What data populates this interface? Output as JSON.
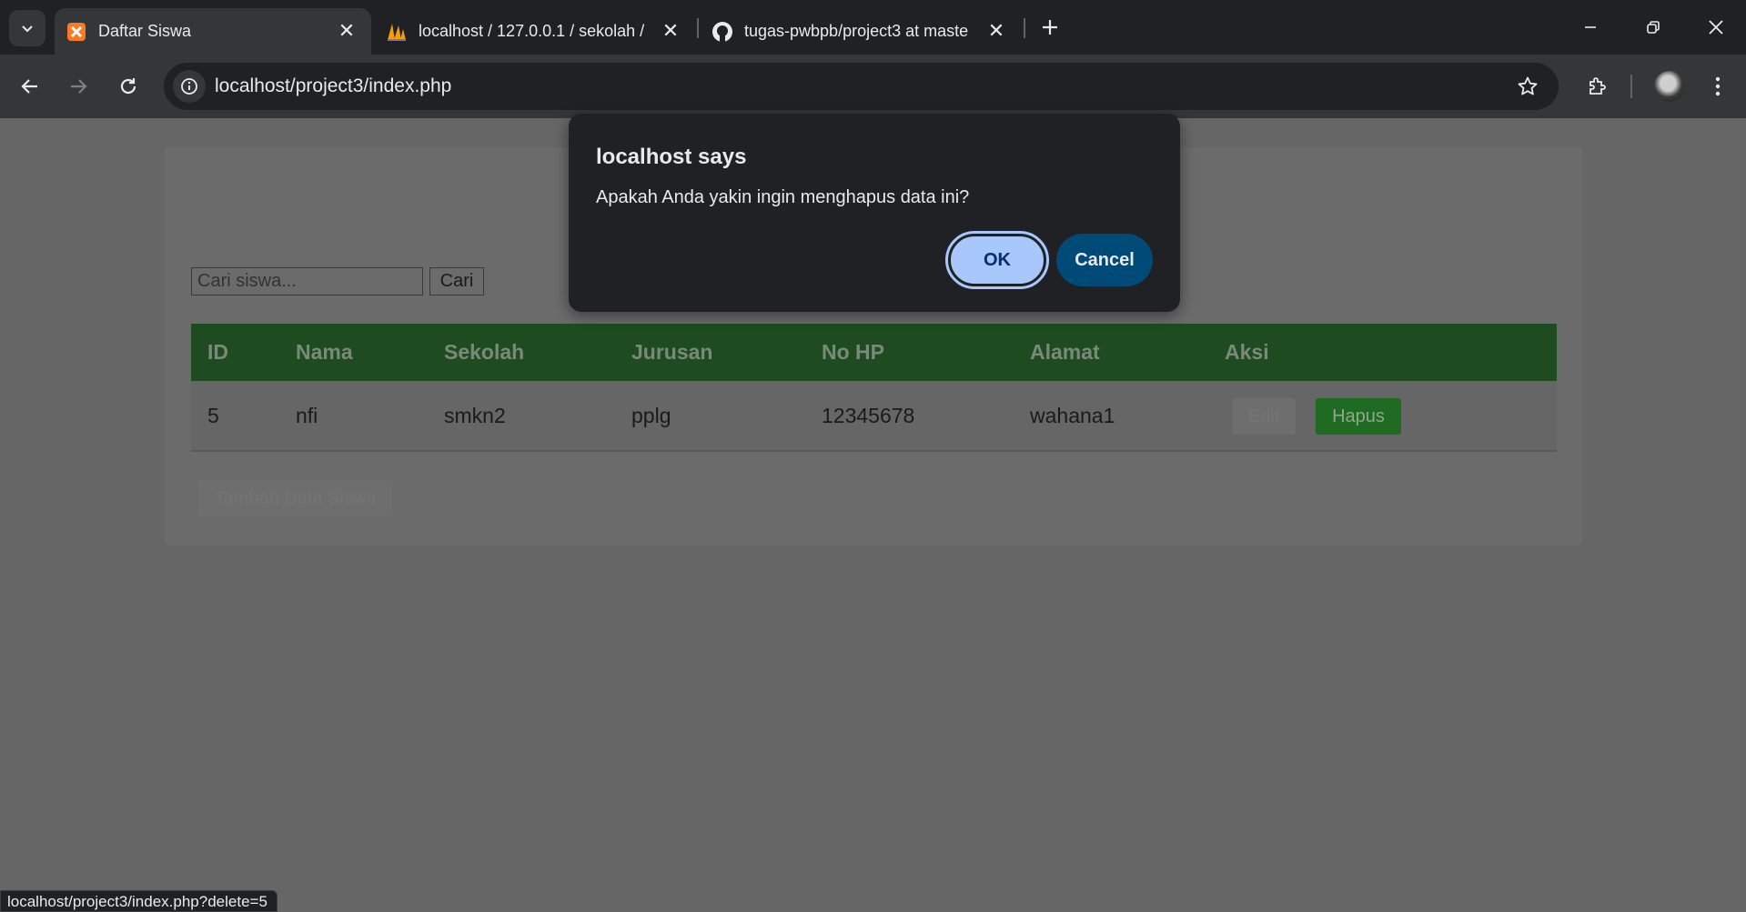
{
  "tabs": [
    {
      "title": "Daftar Siswa",
      "active": true,
      "favicon": "xampp-icon"
    },
    {
      "title": "localhost / 127.0.0.1 / sekolah / ",
      "active": false,
      "favicon": "phpmyadmin-icon"
    },
    {
      "title": "tugas-pwbpb/project3 at maste",
      "active": false,
      "favicon": "github-icon"
    }
  ],
  "toolbar": {
    "url": "localhost/project3/index.php"
  },
  "page": {
    "search_placeholder": "Cari siswa...",
    "search_button": "Cari",
    "table": {
      "headers": [
        "ID",
        "Nama",
        "Sekolah",
        "Jurusan",
        "No HP",
        "Alamat",
        "Aksi"
      ],
      "rows": [
        {
          "id": "5",
          "nama": "nfi",
          "sekolah": "smkn2",
          "jurusan": "pplg",
          "no_hp": "12345678",
          "alamat": "wahana1"
        }
      ],
      "edit_label": "Edit",
      "delete_label": "Hapus"
    },
    "add_button": "Tambah Data Siswa"
  },
  "dialog": {
    "title": "localhost says",
    "message": "Apakah Anda yakin ingin menghapus data ini?",
    "ok_label": "OK",
    "cancel_label": "Cancel"
  },
  "status_url": "localhost/project3/index.php?delete=5",
  "colors": {
    "table_header": "#1f4b20",
    "hapus_button": "#1f6b22",
    "dialog_ok": "#a8c7fa",
    "dialog_cancel": "#004a77"
  }
}
